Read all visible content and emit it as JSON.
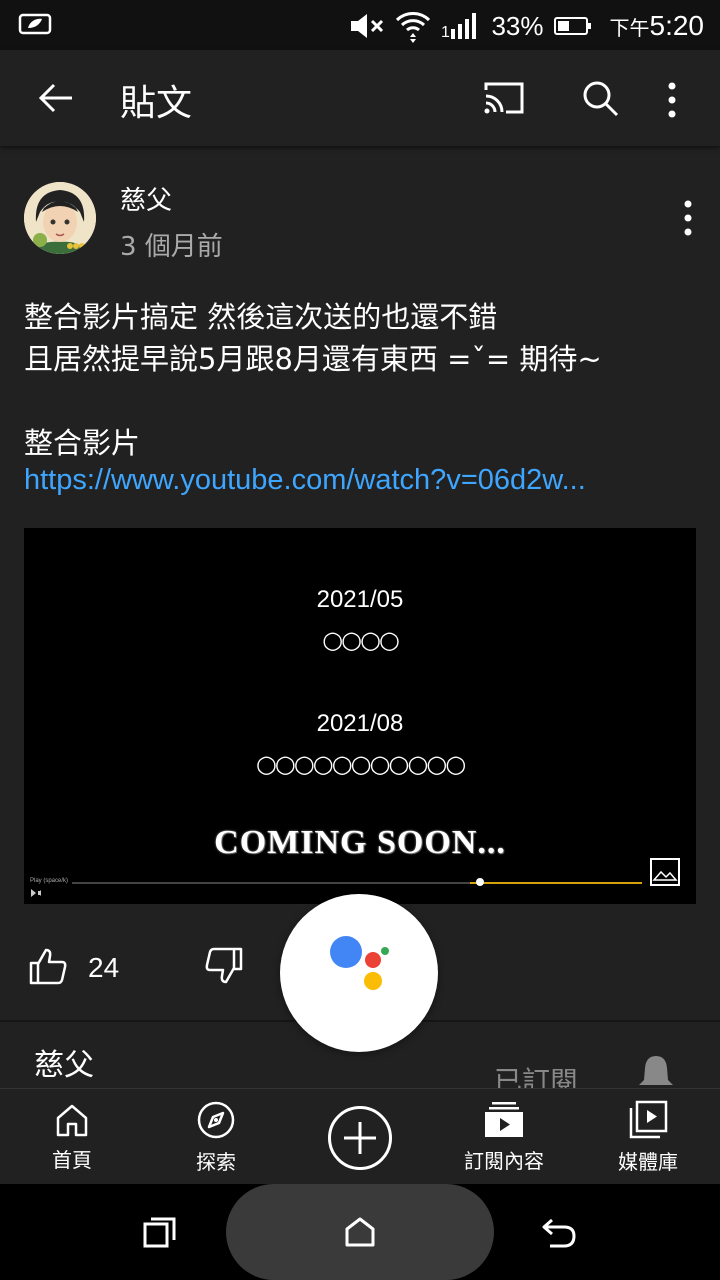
{
  "status_bar": {
    "battery_percent": "33%",
    "time_prefix": "下午",
    "time": "5:20",
    "icons": [
      "notification-icon",
      "mute-icon",
      "wifi-icon",
      "signal-icon",
      "battery-icon"
    ]
  },
  "app_bar": {
    "title": "貼文",
    "icons": [
      "back-arrow-icon",
      "cast-icon",
      "search-icon",
      "more-vert-icon"
    ]
  },
  "post": {
    "author": "慈父",
    "time_ago": "3 個月前",
    "text_lines": [
      "整合影片搞定 然後這次送的也還不錯",
      "且居然提早說5月跟8月還有東西 =ˇ=  期待~",
      "",
      "整合影片"
    ],
    "link": "https://www.youtube.com/watch?v=06d2w...",
    "video": {
      "date1": "2021/05",
      "circles1": "○○○○",
      "date2": "2021/08",
      "circles2": "○○○○○○○○○○○",
      "coming_soon": "COMING SOON...",
      "play_label": "Play (space/k)"
    },
    "like_count": "24"
  },
  "channel_row": {
    "name": "慈父",
    "subscribed_label": "已訂閱"
  },
  "assistant_colors": {
    "blue": "#4285f4",
    "red": "#ea4335",
    "yellow": "#fbbc05",
    "green": "#34a853"
  },
  "bottom_nav": {
    "home": "首頁",
    "explore": "探索",
    "subscriptions": "訂閱內容",
    "library": "媒體庫"
  },
  "colors": {
    "background": "#212121",
    "link": "#3ea6ff",
    "progress": "#d4a20a"
  }
}
